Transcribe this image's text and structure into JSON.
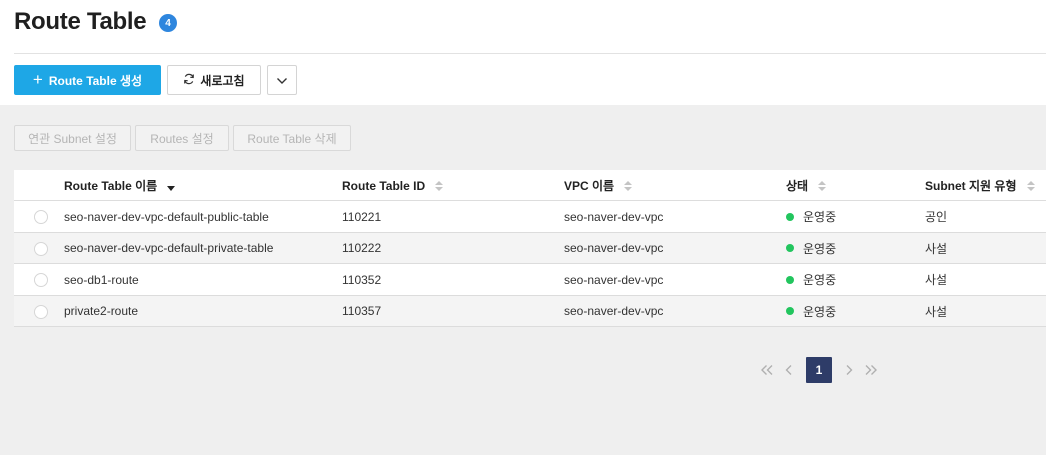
{
  "page": {
    "title": "Route Table",
    "count": "4"
  },
  "toolbar": {
    "create_label": "Route Table 생성",
    "refresh_label": "새로고침"
  },
  "actions": {
    "associate_subnet": "연관 Subnet 설정",
    "routes_settings": "Routes 설정",
    "delete_route_table": "Route Table 삭제"
  },
  "table": {
    "columns": [
      "Route Table 이름",
      "Route Table ID",
      "VPC 이름",
      "상태",
      "Subnet 지원 유형"
    ],
    "rows": [
      {
        "name": "seo-naver-dev-vpc-default-public-table",
        "id": "110221",
        "vpc": "seo-naver-dev-vpc",
        "status": "운영중",
        "type": "공인"
      },
      {
        "name": "seo-naver-dev-vpc-default-private-table",
        "id": "110222",
        "vpc": "seo-naver-dev-vpc",
        "status": "운영중",
        "type": "사설"
      },
      {
        "name": "seo-db1-route",
        "id": "110352",
        "vpc": "seo-naver-dev-vpc",
        "status": "운영중",
        "type": "사설"
      },
      {
        "name": "private2-route",
        "id": "110357",
        "vpc": "seo-naver-dev-vpc",
        "status": "운영중",
        "type": "사설"
      }
    ]
  },
  "pagination": {
    "current_page": "1"
  },
  "colors": {
    "primary": "#1ea7e6",
    "badge": "#2e86de",
    "status_running": "#22c55e",
    "page_active": "#2e3c68"
  },
  "icons": {
    "create": "plus-icon",
    "refresh": "refresh-icon",
    "dropdown": "chevron-down-icon",
    "first": "double-chevron-left-icon",
    "prev": "chevron-left-icon",
    "next": "chevron-right-icon",
    "last": "double-chevron-right-icon"
  }
}
